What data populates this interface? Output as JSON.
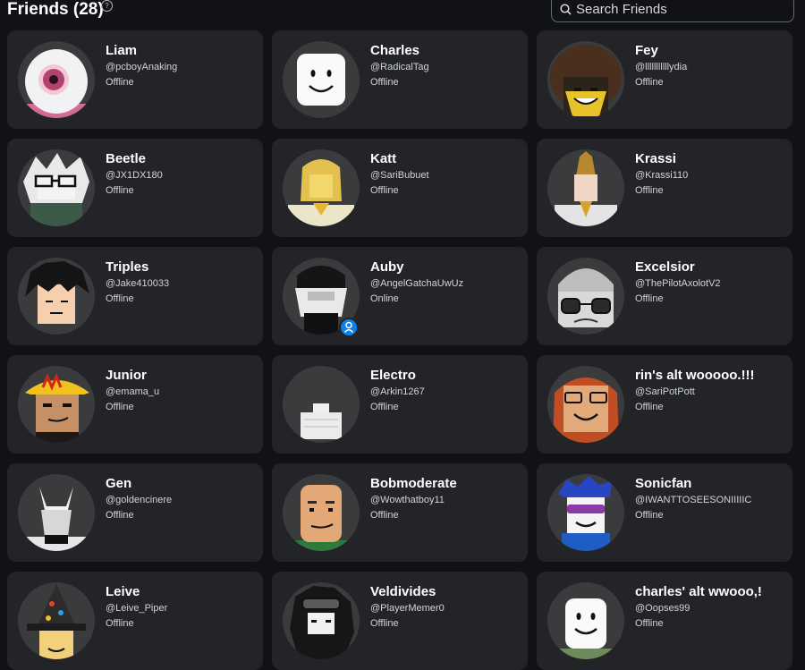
{
  "header": {
    "title": "Friends (28)",
    "help_icon": "question-circle-icon",
    "search_placeholder": "Search Friends"
  },
  "friends": [
    {
      "name": "Liam",
      "handle": "@pcboyAnaking",
      "status": "Offline"
    },
    {
      "name": "Charles",
      "handle": "@RadicalTag",
      "status": "Offline"
    },
    {
      "name": "Fey",
      "handle": "@lllllllllllydia",
      "status": "Offline"
    },
    {
      "name": "Beetle",
      "handle": "@JX1DX180",
      "status": "Offline"
    },
    {
      "name": "Katt",
      "handle": "@SariBubuet",
      "status": "Offline"
    },
    {
      "name": "Krassi",
      "handle": "@Krassi110",
      "status": "Offline"
    },
    {
      "name": "Triples",
      "handle": "@Jake410033",
      "status": "Offline"
    },
    {
      "name": "Auby",
      "handle": "@AngelGatchaUwUz",
      "status": "Online"
    },
    {
      "name": "Excelsior",
      "handle": "@ThePilotAxolotV2",
      "status": "Offline"
    },
    {
      "name": "Junior",
      "handle": "@emama_u",
      "status": "Offline"
    },
    {
      "name": "Electro",
      "handle": "@Arkin1267",
      "status": "Offline"
    },
    {
      "name": "rin's alt wooooo.!!!",
      "handle": "@SariPotPott",
      "status": "Offline"
    },
    {
      "name": "Gen",
      "handle": "@goldencinere",
      "status": "Offline"
    },
    {
      "name": "Bobmoderate",
      "handle": "@Wowthatboy11",
      "status": "Offline"
    },
    {
      "name": "Sonicfan",
      "handle": "@IWANTTOSEESONIIIIIC",
      "status": "Offline"
    },
    {
      "name": "Leive",
      "handle": "@Leive_Piper",
      "status": "Offline"
    },
    {
      "name": "Veldivides",
      "handle": "@PlayerMemer0",
      "status": "Offline"
    },
    {
      "name": "charles' alt wwooo,!",
      "handle": "@Oopses99",
      "status": "Offline"
    }
  ],
  "colors": {
    "background": "#111216",
    "card": "#232428",
    "avatar_bg": "#393b3d",
    "online_badge": "#0a82e8"
  }
}
